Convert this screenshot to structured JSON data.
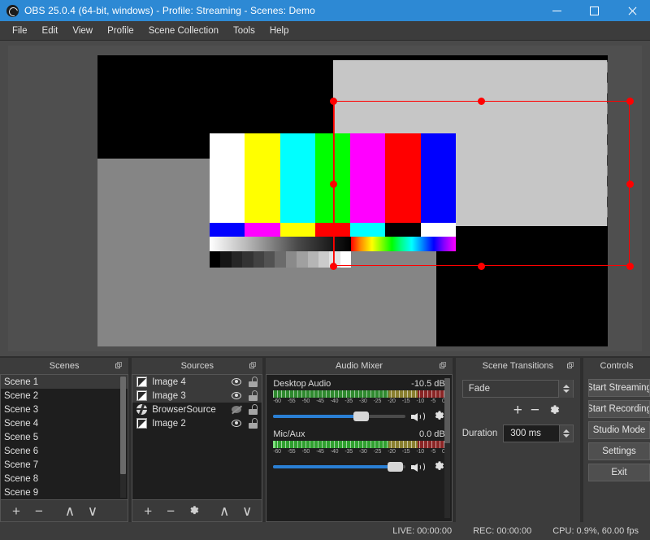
{
  "window": {
    "title": "OBS 25.0.4 (64-bit, windows) - Profile: Streaming - Scenes: Demo",
    "logo_icon": "obs-logo-icon",
    "minimize_icon": "minimize-icon",
    "maximize_icon": "maximize-icon",
    "close_icon": "close-icon",
    "titlebar_color": "#2d89d4"
  },
  "menu": {
    "items": [
      {
        "label": "File"
      },
      {
        "label": "Edit"
      },
      {
        "label": "View"
      },
      {
        "label": "Profile"
      },
      {
        "label": "Scene Collection"
      },
      {
        "label": "Tools"
      },
      {
        "label": "Help"
      }
    ]
  },
  "preview": {
    "name": "preview-canvas",
    "selection_color": "#ff0000",
    "color_bars": [
      "#ffffff",
      "#ffff00",
      "#00ffff",
      "#00ff00",
      "#ff00ff",
      "#ff0000",
      "#0000ff"
    ],
    "color_bars_sub": [
      "#0000ff",
      "#ff00ff",
      "#ffff00",
      "#ff0000",
      "#00ffff",
      "#000000",
      "#ffffff"
    ],
    "step_wedge": [
      "#000000",
      "#151515",
      "#262626",
      "#333333",
      "#424242",
      "#525252",
      "#6b6b6b",
      "#8a8a8a",
      "#a0a0a0",
      "#b5b5b5",
      "#cbcbcb",
      "#e2e2e2",
      "#ffffff"
    ],
    "selected_source_fill": "#c6c6c6",
    "background_gray": "#858585"
  },
  "scenes": {
    "title": "Scenes",
    "float_icon": "undock-icon",
    "items": [
      {
        "label": "Scene 1",
        "selected": true
      },
      {
        "label": "Scene 2",
        "selected": false
      },
      {
        "label": "Scene 3",
        "selected": false
      },
      {
        "label": "Scene 4",
        "selected": false
      },
      {
        "label": "Scene 5",
        "selected": false
      },
      {
        "label": "Scene 6",
        "selected": false
      },
      {
        "label": "Scene 7",
        "selected": false
      },
      {
        "label": "Scene 8",
        "selected": false
      },
      {
        "label": "Scene 9",
        "selected": false
      }
    ],
    "toolbar": {
      "add": "+",
      "remove": "−",
      "move_up": "∧",
      "move_down": "∨"
    }
  },
  "sources": {
    "title": "Sources",
    "float_icon": "undock-icon",
    "items": [
      {
        "label": "Image 4",
        "icon": "image-icon",
        "visible": true,
        "locked": false,
        "selected": true
      },
      {
        "label": "Image 3",
        "icon": "image-icon",
        "visible": true,
        "locked": false,
        "selected": true
      },
      {
        "label": "BrowserSource",
        "icon": "globe-icon",
        "visible": false,
        "locked": false,
        "selected": false
      },
      {
        "label": "Image 2",
        "icon": "image-icon",
        "visible": true,
        "locked": false,
        "selected": false
      }
    ],
    "toolbar": {
      "add": "+",
      "remove": "−",
      "properties": "gear-icon",
      "move_up": "∧",
      "move_down": "∨"
    }
  },
  "audio_mixer": {
    "title": "Audio Mixer",
    "float_icon": "undock-icon",
    "tick_labels": [
      "-60",
      "-55",
      "-50",
      "-45",
      "-40",
      "-35",
      "-30",
      "-25",
      "-20",
      "-15",
      "-10",
      "-5",
      "0"
    ],
    "channels": [
      {
        "name": "Desktop Audio",
        "level": "-10.5 dB",
        "volume_percent": 66,
        "muted": false,
        "meter_active": false,
        "speaker_icon": "speaker-icon",
        "gear_icon": "gear-icon"
      },
      {
        "name": "Mic/Aux",
        "level": "0.0 dB",
        "volume_percent": 92,
        "muted": false,
        "meter_active": true,
        "speaker_icon": "speaker-icon",
        "gear_icon": "gear-icon"
      }
    ]
  },
  "transitions": {
    "title": "Scene Transitions",
    "float_icon": "undock-icon",
    "selected": "Fade",
    "add": "+",
    "remove": "−",
    "properties": "gear-icon",
    "duration_label": "Duration",
    "duration_value": "300 ms"
  },
  "controls": {
    "title": "Controls",
    "buttons": [
      {
        "label": "Start Streaming"
      },
      {
        "label": "Start Recording"
      },
      {
        "label": "Studio Mode"
      },
      {
        "label": "Settings"
      },
      {
        "label": "Exit"
      }
    ]
  },
  "status": {
    "live": "LIVE: 00:00:00",
    "rec": "REC: 00:00:00",
    "cpu": "CPU: 0.9%, 60.00 fps"
  }
}
